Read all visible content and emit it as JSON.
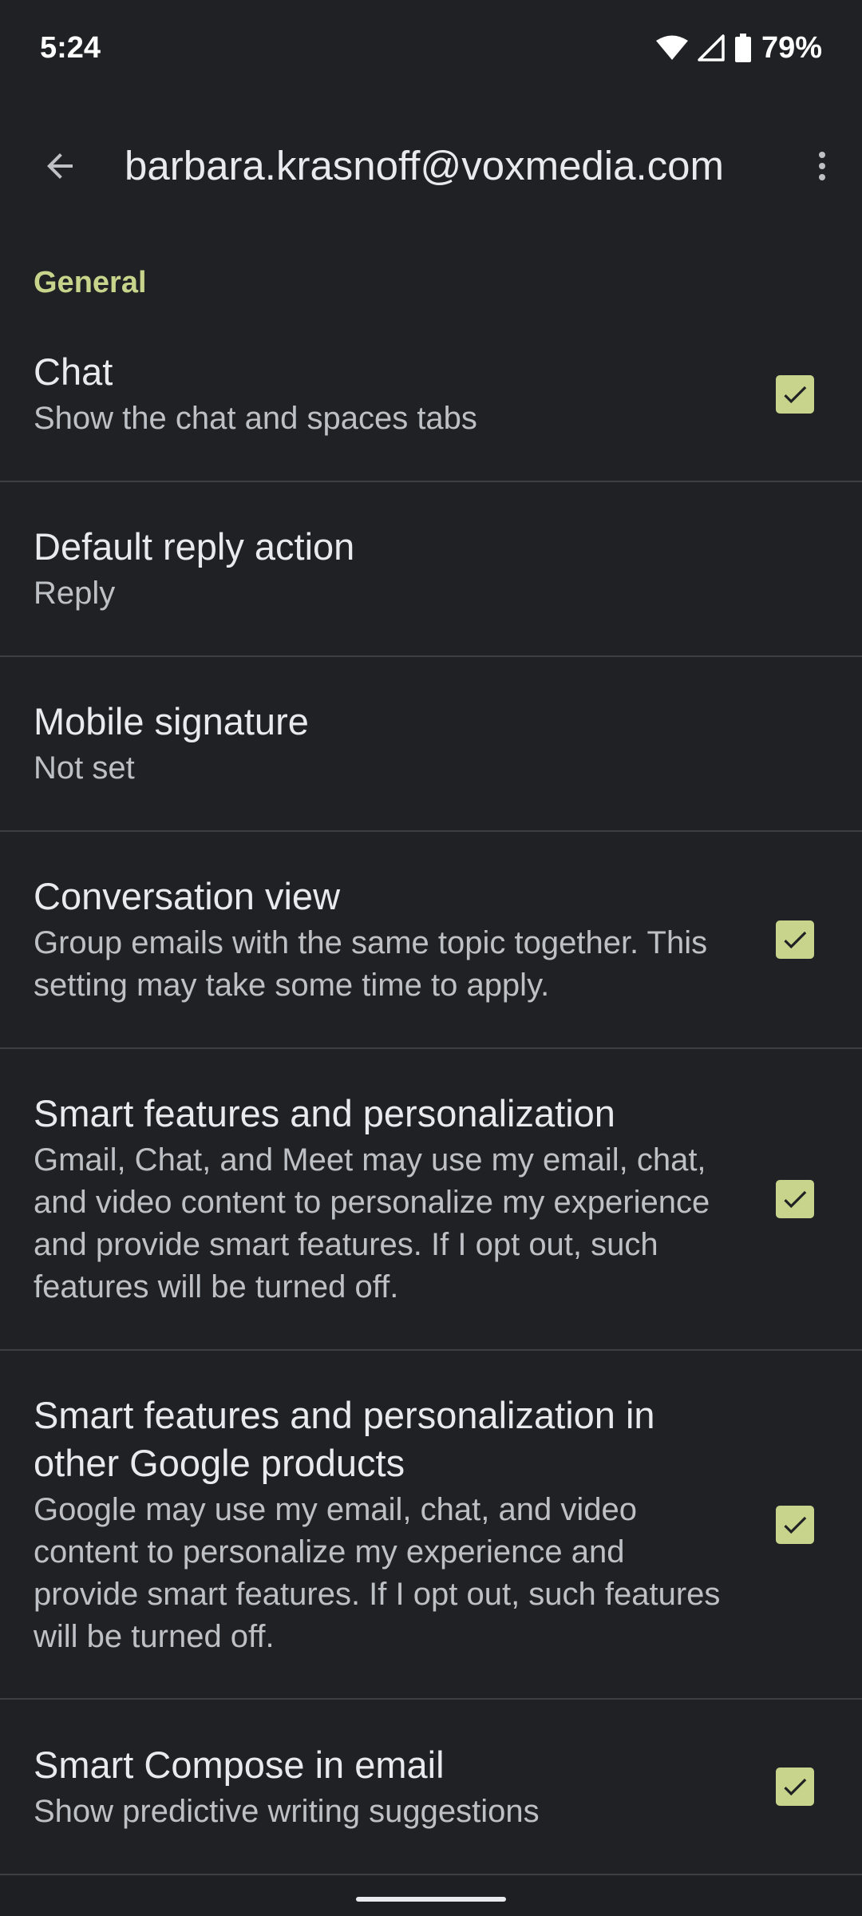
{
  "status_bar": {
    "time": "5:24",
    "battery": "79%"
  },
  "app_bar": {
    "title": "barbara.krasnoff@voxmedia.com",
    "back_icon": "arrow-back-icon",
    "more_icon": "more-vert-icon"
  },
  "section": {
    "title": "General"
  },
  "settings": [
    {
      "title": "Chat",
      "subtitle": "Show the chat and spaces tabs",
      "checked": true
    },
    {
      "title": "Default reply action",
      "subtitle": "Reply"
    },
    {
      "title": "Mobile signature",
      "subtitle": "Not set"
    },
    {
      "title": "Conversation view",
      "subtitle": "Group emails with the same topic together. This setting may take some time to apply.",
      "checked": true
    },
    {
      "title": "Smart features and personalization",
      "subtitle": "Gmail, Chat, and Meet may use my email, chat, and video content to personalize my experience and provide smart features. If I opt out, such features will be turned off.",
      "checked": true
    },
    {
      "title": "Smart features and personalization in other Google products",
      "subtitle": "Google may use my email, chat, and video content to personalize my experience and provide smart features. If I opt out, such features will be turned off.",
      "checked": true
    },
    {
      "title": "Smart Compose in email",
      "subtitle": "Show predictive writing suggestions",
      "checked": true
    }
  ],
  "colors": {
    "background": "#202124",
    "accent": "#c8d38b",
    "divider": "#3c4043"
  }
}
